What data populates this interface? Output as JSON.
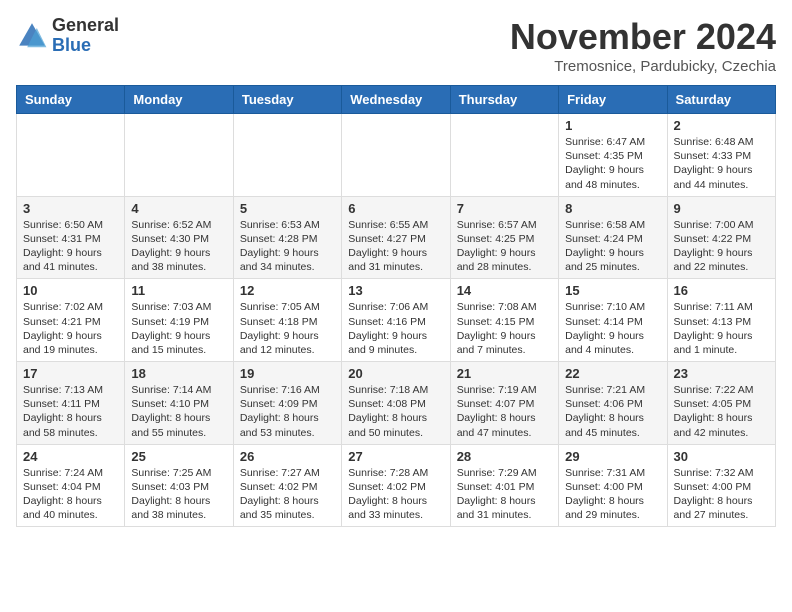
{
  "logo": {
    "general": "General",
    "blue": "Blue"
  },
  "header": {
    "month": "November 2024",
    "location": "Tremosnice, Pardubicky, Czechia"
  },
  "days_of_week": [
    "Sunday",
    "Monday",
    "Tuesday",
    "Wednesday",
    "Thursday",
    "Friday",
    "Saturday"
  ],
  "weeks": [
    [
      {
        "day": "",
        "info": ""
      },
      {
        "day": "",
        "info": ""
      },
      {
        "day": "",
        "info": ""
      },
      {
        "day": "",
        "info": ""
      },
      {
        "day": "",
        "info": ""
      },
      {
        "day": "1",
        "info": "Sunrise: 6:47 AM\nSunset: 4:35 PM\nDaylight: 9 hours and 48 minutes."
      },
      {
        "day": "2",
        "info": "Sunrise: 6:48 AM\nSunset: 4:33 PM\nDaylight: 9 hours and 44 minutes."
      }
    ],
    [
      {
        "day": "3",
        "info": "Sunrise: 6:50 AM\nSunset: 4:31 PM\nDaylight: 9 hours and 41 minutes."
      },
      {
        "day": "4",
        "info": "Sunrise: 6:52 AM\nSunset: 4:30 PM\nDaylight: 9 hours and 38 minutes."
      },
      {
        "day": "5",
        "info": "Sunrise: 6:53 AM\nSunset: 4:28 PM\nDaylight: 9 hours and 34 minutes."
      },
      {
        "day": "6",
        "info": "Sunrise: 6:55 AM\nSunset: 4:27 PM\nDaylight: 9 hours and 31 minutes."
      },
      {
        "day": "7",
        "info": "Sunrise: 6:57 AM\nSunset: 4:25 PM\nDaylight: 9 hours and 28 minutes."
      },
      {
        "day": "8",
        "info": "Sunrise: 6:58 AM\nSunset: 4:24 PM\nDaylight: 9 hours and 25 minutes."
      },
      {
        "day": "9",
        "info": "Sunrise: 7:00 AM\nSunset: 4:22 PM\nDaylight: 9 hours and 22 minutes."
      }
    ],
    [
      {
        "day": "10",
        "info": "Sunrise: 7:02 AM\nSunset: 4:21 PM\nDaylight: 9 hours and 19 minutes."
      },
      {
        "day": "11",
        "info": "Sunrise: 7:03 AM\nSunset: 4:19 PM\nDaylight: 9 hours and 15 minutes."
      },
      {
        "day": "12",
        "info": "Sunrise: 7:05 AM\nSunset: 4:18 PM\nDaylight: 9 hours and 12 minutes."
      },
      {
        "day": "13",
        "info": "Sunrise: 7:06 AM\nSunset: 4:16 PM\nDaylight: 9 hours and 9 minutes."
      },
      {
        "day": "14",
        "info": "Sunrise: 7:08 AM\nSunset: 4:15 PM\nDaylight: 9 hours and 7 minutes."
      },
      {
        "day": "15",
        "info": "Sunrise: 7:10 AM\nSunset: 4:14 PM\nDaylight: 9 hours and 4 minutes."
      },
      {
        "day": "16",
        "info": "Sunrise: 7:11 AM\nSunset: 4:13 PM\nDaylight: 9 hours and 1 minute."
      }
    ],
    [
      {
        "day": "17",
        "info": "Sunrise: 7:13 AM\nSunset: 4:11 PM\nDaylight: 8 hours and 58 minutes."
      },
      {
        "day": "18",
        "info": "Sunrise: 7:14 AM\nSunset: 4:10 PM\nDaylight: 8 hours and 55 minutes."
      },
      {
        "day": "19",
        "info": "Sunrise: 7:16 AM\nSunset: 4:09 PM\nDaylight: 8 hours and 53 minutes."
      },
      {
        "day": "20",
        "info": "Sunrise: 7:18 AM\nSunset: 4:08 PM\nDaylight: 8 hours and 50 minutes."
      },
      {
        "day": "21",
        "info": "Sunrise: 7:19 AM\nSunset: 4:07 PM\nDaylight: 8 hours and 47 minutes."
      },
      {
        "day": "22",
        "info": "Sunrise: 7:21 AM\nSunset: 4:06 PM\nDaylight: 8 hours and 45 minutes."
      },
      {
        "day": "23",
        "info": "Sunrise: 7:22 AM\nSunset: 4:05 PM\nDaylight: 8 hours and 42 minutes."
      }
    ],
    [
      {
        "day": "24",
        "info": "Sunrise: 7:24 AM\nSunset: 4:04 PM\nDaylight: 8 hours and 40 minutes."
      },
      {
        "day": "25",
        "info": "Sunrise: 7:25 AM\nSunset: 4:03 PM\nDaylight: 8 hours and 38 minutes."
      },
      {
        "day": "26",
        "info": "Sunrise: 7:27 AM\nSunset: 4:02 PM\nDaylight: 8 hours and 35 minutes."
      },
      {
        "day": "27",
        "info": "Sunrise: 7:28 AM\nSunset: 4:02 PM\nDaylight: 8 hours and 33 minutes."
      },
      {
        "day": "28",
        "info": "Sunrise: 7:29 AM\nSunset: 4:01 PM\nDaylight: 8 hours and 31 minutes."
      },
      {
        "day": "29",
        "info": "Sunrise: 7:31 AM\nSunset: 4:00 PM\nDaylight: 8 hours and 29 minutes."
      },
      {
        "day": "30",
        "info": "Sunrise: 7:32 AM\nSunset: 4:00 PM\nDaylight: 8 hours and 27 minutes."
      }
    ]
  ]
}
